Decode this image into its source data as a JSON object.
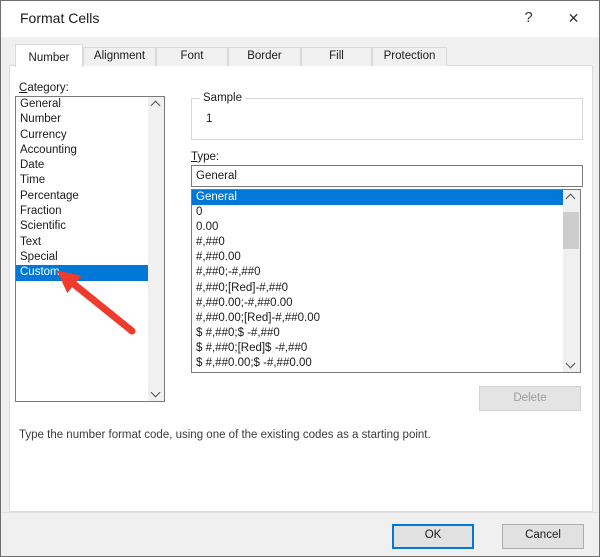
{
  "window": {
    "title": "Format Cells",
    "help_glyph": "?",
    "close_glyph": "✕"
  },
  "tabs": {
    "active": "Number",
    "items": [
      "Number",
      "Alignment",
      "Font",
      "Border",
      "Fill",
      "Protection"
    ]
  },
  "category": {
    "label_accel": "C",
    "label_rest": "ategory:",
    "items": [
      "General",
      "Number",
      "Currency",
      "Accounting",
      "Date",
      "Time",
      "Percentage",
      "Fraction",
      "Scientific",
      "Text",
      "Special",
      "Custom"
    ],
    "selected": "Custom"
  },
  "sample": {
    "label": "Sample",
    "value": "1"
  },
  "type": {
    "label_accel": "T",
    "label_rest": "ype:",
    "input_value": "General",
    "items": [
      "General",
      "0",
      "0.00",
      "#,##0",
      "#,##0.00",
      "#,##0;-#,##0",
      "#,##0;[Red]-#,##0",
      "#,##0.00;-#,##0.00",
      "#,##0.00;[Red]-#,##0.00",
      "$ #,##0;$ -#,##0",
      "$ #,##0;[Red]$ -#,##0",
      "$ #,##0.00;$ -#,##0.00"
    ],
    "selected": "General"
  },
  "buttons": {
    "delete": "Delete",
    "ok": "OK",
    "cancel": "Cancel"
  },
  "description": "Type the number format code, using one of the existing codes as a starting point.",
  "annotation": {
    "type": "arrow",
    "points_to": "Custom",
    "color": "#ef3b2d"
  },
  "colors": {
    "selection": "#0078d7",
    "default_button_border": "#0078d7",
    "arrow": "#ef3b2d",
    "dialog_bg": "#f0f0f0"
  }
}
